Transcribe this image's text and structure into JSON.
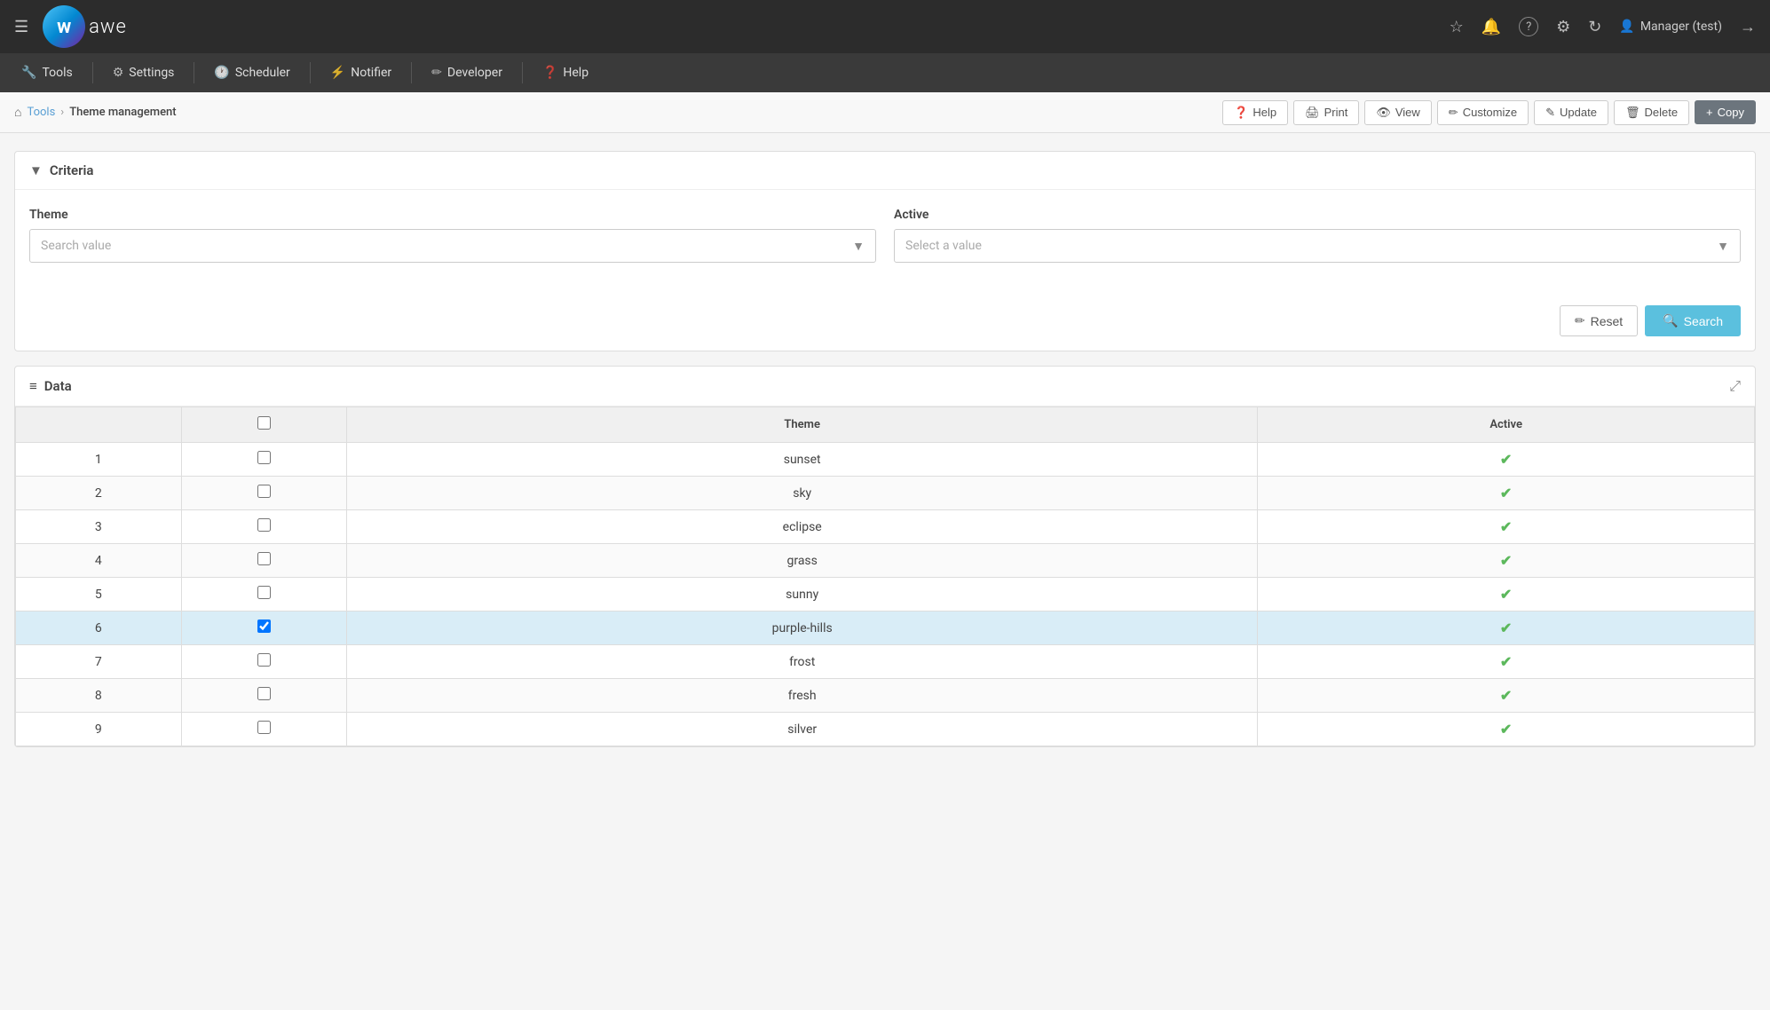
{
  "app": {
    "name": "awe"
  },
  "topnav": {
    "hamburger": "☰",
    "icons": {
      "star": "☆",
      "bell": "🔔",
      "question": "?",
      "gear": "⚙",
      "refresh": "↻",
      "user": "👤",
      "logout": "→"
    },
    "user_label": "Manager (test)"
  },
  "menubar": {
    "items": [
      {
        "id": "tools",
        "icon": "🔧",
        "label": "Tools"
      },
      {
        "id": "settings",
        "icon": "⚙",
        "label": "Settings"
      },
      {
        "id": "scheduler",
        "icon": "🕐",
        "label": "Scheduler"
      },
      {
        "id": "notifier",
        "icon": "⚡",
        "label": "Notifier"
      },
      {
        "id": "developer",
        "icon": "✏",
        "label": "Developer"
      },
      {
        "id": "help",
        "icon": "?",
        "label": "Help"
      }
    ]
  },
  "breadcrumb": {
    "home_icon": "⌂",
    "tools_link": "Tools",
    "separator": "›",
    "current": "Theme management",
    "actions": [
      {
        "id": "help",
        "icon": "?",
        "label": "Help"
      },
      {
        "id": "print",
        "icon": "🖨",
        "label": "Print"
      },
      {
        "id": "view",
        "icon": "👁",
        "label": "View"
      },
      {
        "id": "customize",
        "icon": "✏",
        "label": "Customize"
      },
      {
        "id": "update",
        "icon": "✎",
        "label": "Update"
      },
      {
        "id": "delete",
        "icon": "🗑",
        "label": "Delete"
      },
      {
        "id": "copy",
        "icon": "+",
        "label": "Copy"
      }
    ]
  },
  "criteria": {
    "section_title": "Criteria",
    "filter_icon": "▼",
    "fields": [
      {
        "id": "theme",
        "label": "Theme",
        "placeholder": "Search value",
        "type": "search"
      },
      {
        "id": "active",
        "label": "Active",
        "placeholder": "Select a value",
        "type": "select"
      }
    ],
    "reset_label": "Reset",
    "search_label": "Search"
  },
  "data_section": {
    "title": "Data",
    "list_icon": "≡",
    "expand_icon": "⤢",
    "columns": [
      {
        "id": "checkbox",
        "label": ""
      },
      {
        "id": "theme",
        "label": "Theme"
      },
      {
        "id": "active",
        "label": "Active"
      }
    ],
    "rows": [
      {
        "num": 1,
        "theme": "sunset",
        "active": true,
        "selected": false
      },
      {
        "num": 2,
        "theme": "sky",
        "active": true,
        "selected": false
      },
      {
        "num": 3,
        "theme": "eclipse",
        "active": true,
        "selected": false
      },
      {
        "num": 4,
        "theme": "grass",
        "active": true,
        "selected": false
      },
      {
        "num": 5,
        "theme": "sunny",
        "active": true,
        "selected": false
      },
      {
        "num": 6,
        "theme": "purple-hills",
        "active": true,
        "selected": true
      },
      {
        "num": 7,
        "theme": "frost",
        "active": true,
        "selected": false
      },
      {
        "num": 8,
        "theme": "fresh",
        "active": true,
        "selected": false
      },
      {
        "num": 9,
        "theme": "silver",
        "active": true,
        "selected": false
      }
    ]
  }
}
